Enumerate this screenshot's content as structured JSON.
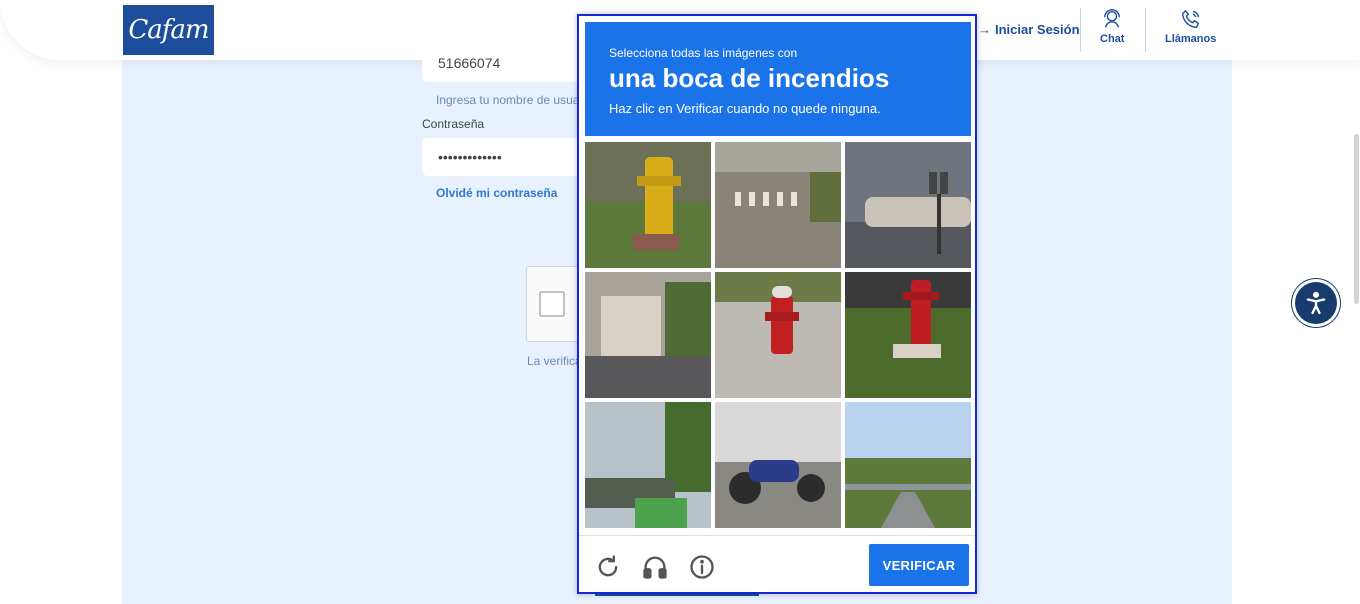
{
  "header": {
    "logo_text": "Cafam",
    "login_label": "Iniciar Sesión",
    "chat_label": "Chat",
    "call_label": "Llámanos"
  },
  "form": {
    "username_value": "51666074",
    "username_hint": "Ingresa tu nombre de usua",
    "password_label": "Contraseña",
    "password_value": "•••••••••••••",
    "forgot_label": "Olvidé mi contraseña",
    "recaptcha_note": "La verifica"
  },
  "challenge": {
    "instruction_top": "Selecciona todas las imágenes con",
    "target_object": "una boca de incendios",
    "instruction_bottom": "Haz clic en Verificar cuando no quede ninguna.",
    "verify_label": "VERIFICAR",
    "tiles": [
      {
        "content": "yellow hydrant on grass"
      },
      {
        "content": "road crosswalk"
      },
      {
        "content": "parking meters"
      },
      {
        "content": "street with buildings"
      },
      {
        "content": "red hydrant on sidewalk"
      },
      {
        "content": "red hydrant on grass"
      },
      {
        "content": "street with trees"
      },
      {
        "content": "motorcycle"
      },
      {
        "content": "highway"
      }
    ]
  },
  "colors": {
    "brand": "#1c4e9b",
    "challenge_blue": "#1a73e8",
    "page_bg": "#e8f2ff"
  }
}
